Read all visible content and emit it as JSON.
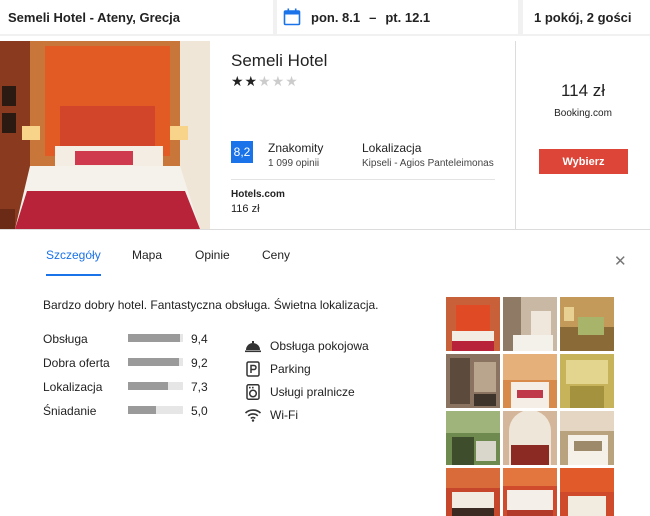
{
  "search": {
    "destination": "Semeli Hotel - Ateny, Grecja",
    "check_in": "pon. 8.1",
    "dash": "–",
    "check_out": "pt. 12.1",
    "rooms_guests": "1 pokój, 2 gości"
  },
  "hotel": {
    "name": "Semeli Hotel",
    "stars_filled": 2,
    "stars_total": 5,
    "star_filled_glyph": "★★",
    "star_empty_glyph": "★★★",
    "score": "8,2",
    "score_word": "Znakomity",
    "review_count": "1 099 opinii",
    "location_title": "Lokalizacja",
    "location_value": "Kipseli - Agios Panteleimonas",
    "provider": "Hotels.com",
    "provider_price": "116 zł",
    "price": "114 zł",
    "price_source": "Booking.com",
    "select_label": "Wybierz"
  },
  "tabs": [
    {
      "label": "Szczegóły",
      "active": true
    },
    {
      "label": "Mapa",
      "active": false
    },
    {
      "label": "Opinie",
      "active": false
    },
    {
      "label": "Ceny",
      "active": false
    }
  ],
  "close_glyph": "✕",
  "details": {
    "summary": "Bardzo dobry hotel. Fantastyczna obsługa. Świetna lokalizacja.",
    "ratings": [
      {
        "label": "Obsługa",
        "value": "9,4",
        "fraction": 0.94
      },
      {
        "label": "Dobra oferta",
        "value": "9,2",
        "fraction": 0.92
      },
      {
        "label": "Lokalizacja",
        "value": "7,3",
        "fraction": 0.73
      },
      {
        "label": "Śniadanie",
        "value": "5,0",
        "fraction": 0.5
      }
    ],
    "amenities": [
      {
        "label": "Obsługa pokojowa",
        "icon": "room-service-icon"
      },
      {
        "label": "Parking",
        "icon": "parking-icon"
      },
      {
        "label": "Usługi pralnicze",
        "icon": "laundry-icon"
      },
      {
        "label": "Wi-Fi",
        "icon": "wifi-icon"
      }
    ]
  },
  "colors": {
    "accent_blue": "#1a73e8",
    "select_red": "#dc4537",
    "bar_fill": "#9a9a9a"
  }
}
